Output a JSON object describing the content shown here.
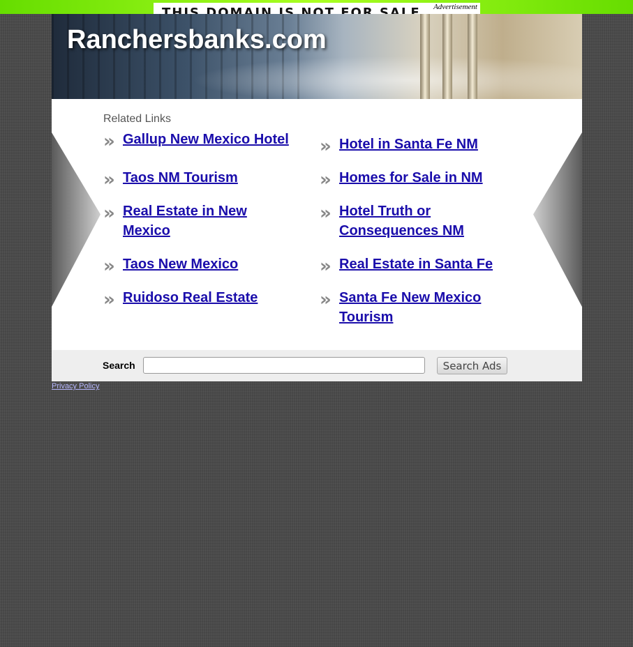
{
  "ad": {
    "banner_text": "THIS DOMAIN IS NOT FOR SALE",
    "label": "Advertisement"
  },
  "header": {
    "site_title": "Ranchersbanks.com"
  },
  "related": {
    "title": "Related Links",
    "left": [
      {
        "label": "Gallup New Mexico Hotel"
      },
      {
        "label": "Taos NM Tourism"
      },
      {
        "label": "Real Estate in New Mexico"
      },
      {
        "label": "Taos New Mexico"
      },
      {
        "label": "Ruidoso Real Estate"
      }
    ],
    "right": [
      {
        "label": "Hotel in Santa Fe NM"
      },
      {
        "label": "Homes for Sale in NM"
      },
      {
        "label": "Hotel Truth or Consequences NM"
      },
      {
        "label": "Real Estate in Santa Fe"
      },
      {
        "label": "Santa Fe New Mexico Tourism"
      }
    ],
    "arrow_glyph": "»"
  },
  "search": {
    "label": "Search",
    "input_value": "",
    "button_label": "Search Ads"
  },
  "footer": {
    "privacy_label": "Privacy Policy"
  },
  "colors": {
    "top_bar": "#88ee11",
    "link": "#1a0dab",
    "background": "#4a4a4a"
  }
}
